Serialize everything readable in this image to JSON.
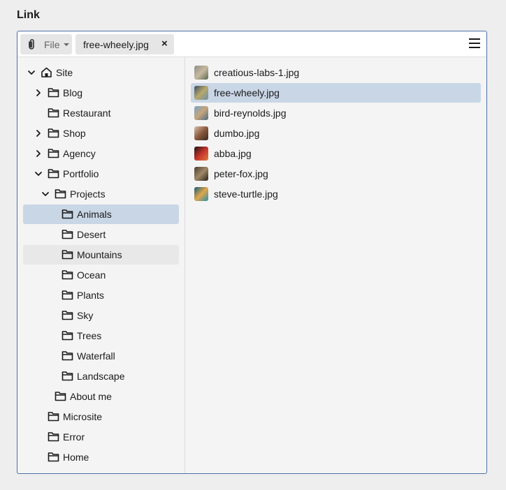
{
  "field_label": "Link",
  "toolbar": {
    "type_label": "File",
    "selected_chip": "free-wheely.jpg",
    "chip_remove": "×"
  },
  "tree": [
    {
      "label": "Site",
      "level": 0,
      "expander": "expanded",
      "icon": "home-icon",
      "state": ""
    },
    {
      "label": "Blog",
      "level": 1,
      "expander": "collapsed",
      "icon": "folder-icon",
      "state": ""
    },
    {
      "label": "Restaurant",
      "level": 1,
      "expander": "none",
      "icon": "folder-icon",
      "state": ""
    },
    {
      "label": "Shop",
      "level": 1,
      "expander": "collapsed",
      "icon": "folder-icon",
      "state": ""
    },
    {
      "label": "Agency",
      "level": 1,
      "expander": "collapsed",
      "icon": "folder-icon",
      "state": ""
    },
    {
      "label": "Portfolio",
      "level": 1,
      "expander": "expanded",
      "icon": "folder-icon",
      "state": ""
    },
    {
      "label": "Projects",
      "level": 2,
      "expander": "expanded",
      "icon": "folder-icon",
      "state": ""
    },
    {
      "label": "Animals",
      "level": 3,
      "expander": "none",
      "icon": "folder-icon",
      "state": "selected"
    },
    {
      "label": "Desert",
      "level": 3,
      "expander": "none",
      "icon": "folder-icon",
      "state": ""
    },
    {
      "label": "Mountains",
      "level": 3,
      "expander": "none",
      "icon": "folder-icon",
      "state": "hover"
    },
    {
      "label": "Ocean",
      "level": 3,
      "expander": "none",
      "icon": "folder-icon",
      "state": ""
    },
    {
      "label": "Plants",
      "level": 3,
      "expander": "none",
      "icon": "folder-icon",
      "state": ""
    },
    {
      "label": "Sky",
      "level": 3,
      "expander": "none",
      "icon": "folder-icon",
      "state": ""
    },
    {
      "label": "Trees",
      "level": 3,
      "expander": "none",
      "icon": "folder-icon",
      "state": ""
    },
    {
      "label": "Waterfall",
      "level": 3,
      "expander": "none",
      "icon": "folder-icon",
      "state": ""
    },
    {
      "label": "Landscape",
      "level": 3,
      "expander": "none",
      "icon": "folder-icon",
      "state": ""
    },
    {
      "label": "About me",
      "level": 2,
      "expander": "none",
      "icon": "folder-icon",
      "state": ""
    },
    {
      "label": "Microsite",
      "level": 1,
      "expander": "none",
      "icon": "folder-icon",
      "state": ""
    },
    {
      "label": "Error",
      "level": 1,
      "expander": "none",
      "icon": "folder-icon",
      "state": ""
    },
    {
      "label": "Home",
      "level": 1,
      "expander": "none",
      "icon": "folder-icon",
      "state": ""
    }
  ],
  "files": [
    {
      "name": "creatious-labs-1.jpg",
      "colors": [
        "#8c8f86",
        "#c7b9a0",
        "#5b6b4f"
      ],
      "selected": false
    },
    {
      "name": "free-wheely.jpg",
      "colors": [
        "#3b4a63",
        "#b7a96a",
        "#6f8ea8"
      ],
      "selected": true
    },
    {
      "name": "bird-reynolds.jpg",
      "colors": [
        "#7aa3c4",
        "#c6a57c",
        "#4f6a82"
      ],
      "selected": false
    },
    {
      "name": "dumbo.jpg",
      "colors": [
        "#d8c0ae",
        "#8a5a3b",
        "#3b2a22"
      ],
      "selected": false
    },
    {
      "name": "abba.jpg",
      "colors": [
        "#1a1414",
        "#c4332b",
        "#e07a3a"
      ],
      "selected": false
    },
    {
      "name": "peter-fox.jpg",
      "colors": [
        "#4a3f33",
        "#a08866",
        "#2b231c"
      ],
      "selected": false
    },
    {
      "name": "steve-turtle.jpg",
      "colors": [
        "#0f5a7a",
        "#e3a64a",
        "#2a8fae"
      ],
      "selected": false
    }
  ],
  "colors": {
    "accent_border": "#4d6fa8",
    "selection": "#c9d6e6",
    "hover": "#e8e8e8"
  }
}
